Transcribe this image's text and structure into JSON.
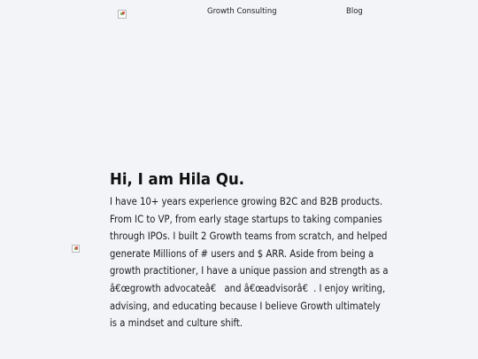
{
  "nav": {
    "brand_icon": "broken-image-icon",
    "items": [
      {
        "label": "Growth Consulting"
      },
      {
        "label": "Blog"
      }
    ]
  },
  "hero": {
    "image_icon": "broken-image-icon",
    "title": "Hi, I am Hila Qu.",
    "bio": "I have 10+ years experience growing B2C and B2B products. From IC to VP, from early stage startups to taking companies through IPOs. I built 2 Growth teams from scratch, and helped generate Millions of # users and $ ARR. Aside from being a growth practitioner, I have a unique passion and strength as a â€œgrowth advocateâ€ and â€œadvisorâ€. I enjoy writing, advising, and educating because I believe Growth ultimately is a mindset and culture shift."
  }
}
